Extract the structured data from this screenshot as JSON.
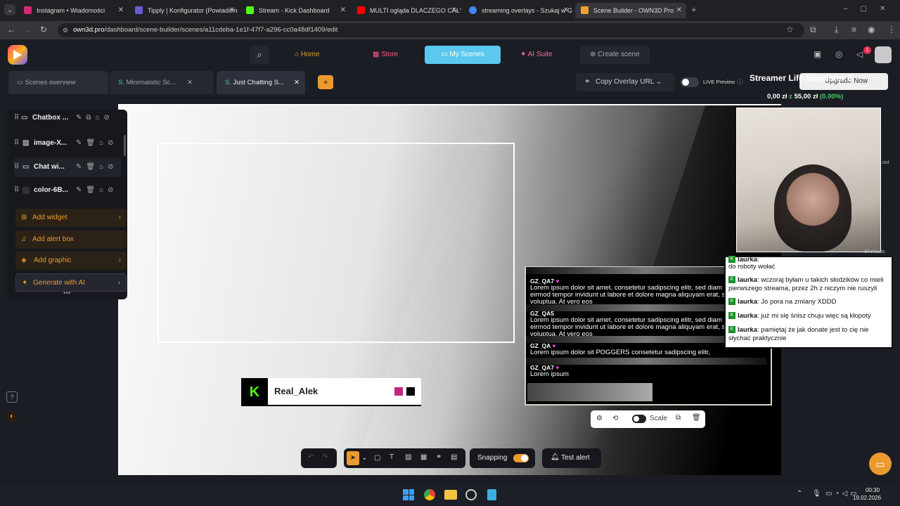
{
  "browser": {
    "tabs": [
      {
        "label": "Instagram • Wiadomości",
        "color": "#d6287b"
      },
      {
        "label": "Tipply | Konfigurator (Powiadom",
        "color": "#6b5bd6"
      },
      {
        "label": "Stream - Kick Dashboard",
        "color": "#53fc18"
      },
      {
        "label": "MULTI ogląda DLACZEGO CAŁY",
        "color": "#ff0000"
      },
      {
        "label": "streaming overlays - Szukaj w G",
        "color": "#4285f4"
      },
      {
        "label": "Scene Builder - OWN3D Pro",
        "color": "#f0a030"
      }
    ],
    "url_host": "own3d.pro",
    "url_path": "/dashboard/scene-builder/scenes/a11cdeba-1e1f-47f7-a296-cc0a48df1409/edit"
  },
  "header": {
    "nav": [
      {
        "label": "Home",
        "icon": "home-icon"
      },
      {
        "label": "Store",
        "icon": "store-icon"
      },
      {
        "label": "My Scenes",
        "icon": "folder-icon"
      },
      {
        "label": "AI Suite",
        "icon": "ai-icon"
      },
      {
        "label": "Create scene",
        "icon": "plus-circle-icon"
      }
    ],
    "notification_count": "1"
  },
  "scene_tabs": {
    "overview": "Scenes overview",
    "tab1": "Minimalistic Sc...",
    "tab2": "Just Chatting S...",
    "copy_overlay": "Copy Overlay URL",
    "live_preview": "LIVE Preview",
    "upgrade": "Upgrade Now"
  },
  "layers": {
    "items": [
      "Chatbox ...",
      "image-X...",
      "Chat wi...",
      "color-6B..."
    ],
    "add_widget": "Add widget",
    "add_alert": "Add alert box",
    "add_graphic": "Add graphic",
    "generate_ai": "Generate with AI"
  },
  "canvas": {
    "kick_name": "Real_Alek",
    "chat_messages": [
      {
        "user": "GZ_QA7",
        "text": "Lorem ipsum dolor sit amet, consetetur sadipscing elitr, sed diam nonumy eirmod tempor invidunt ut labore et dolore magna aliquyam erat, sed diam voluptua. At vero eos"
      },
      {
        "user": "GZ_QA5",
        "text": "Lorem ipsum dolor sit amet, consetetur sadipscing elitr, sed diam nonumy eirmod tempor invidunt ut labore et dolore magna aliquyam erat, sed diam voluptua. At vero eos"
      },
      {
        "user": "GZ_QA",
        "text": "Lorem ipsum dolor sit POGGERS consetetur sadipscing elitr,"
      },
      {
        "user": "GZ_QA7",
        "text": "Lorem ipsum"
      }
    ],
    "scale_label": "Scale"
  },
  "bottom_toolbar": {
    "snapping": "Snapping",
    "test_alert": "Test alert"
  },
  "streamer_overlay": {
    "title": "Streamer Life Simulator 2",
    "money": "0,00 zł",
    "money_sep": "z",
    "goal": "55,00 zł",
    "percent": "(0.00%)"
  },
  "stream_chat": [
    {
      "user": "laurka",
      "text": "do roboty wołać",
      "partial": true
    },
    {
      "user": "laurka",
      "text": "wczoraj byłam u takich słodzików co mieli pierwszego streama, przez 2h z niczym nie ruszyli"
    },
    {
      "user": "laurka",
      "text": "Jo pora na zmiany XDDD"
    },
    {
      "user": "laurka",
      "text": "już mi się śnisz chuju więc są kłopoty"
    },
    {
      "user": "laurka",
      "text": "pamiętaj że jak donate jest to cię nie słychać praktycznie"
    }
  ],
  "side_labels": [
    "out",
    "Shortcuts"
  ],
  "taskbar": {
    "time": "00:30",
    "date": "19.02.2026"
  },
  "colors": {
    "accent": "#ec9a2f",
    "nav_active": "#5cc8f0",
    "kick_green": "#53fc18",
    "money_green": "#41d16b"
  }
}
